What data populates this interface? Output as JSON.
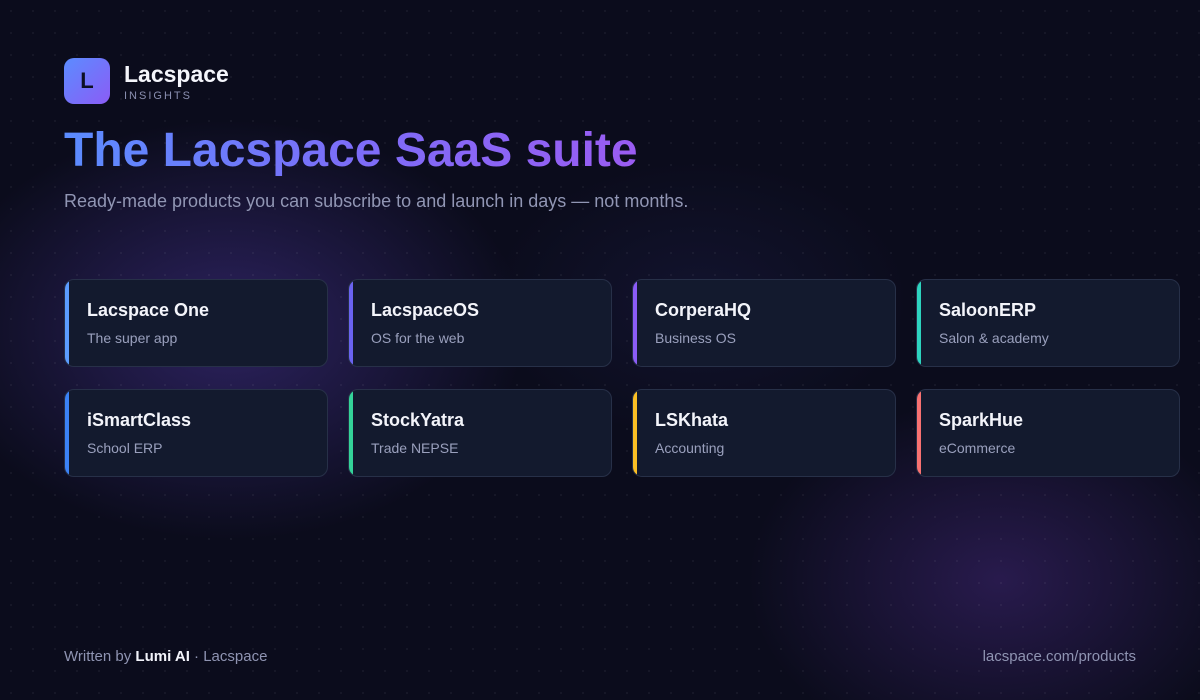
{
  "brand": {
    "logo_letter": "L",
    "name": "Lacspace",
    "tagline": "INSIGHTS"
  },
  "headline": "The Lacspace SaaS suite",
  "subheadline": "Ready-made products you can subscribe to and launch in days — not months.",
  "products": [
    {
      "name": "Lacspace One",
      "description": "The super app",
      "accent": "#5b9cff"
    },
    {
      "name": "LacspaceOS",
      "description": "OS for the web",
      "accent": "#6a63f0"
    },
    {
      "name": "CorperaHQ",
      "description": "Business OS",
      "accent": "#8b5cf6"
    },
    {
      "name": "SaloonERP",
      "description": "Salon & academy",
      "accent": "#2dd4bf"
    },
    {
      "name": "iSmartClass",
      "description": "School ERP",
      "accent": "#3b82f6"
    },
    {
      "name": "StockYatra",
      "description": "Trade NEPSE",
      "accent": "#34d399"
    },
    {
      "name": "LSKhata",
      "description": "Accounting",
      "accent": "#fbbf24"
    },
    {
      "name": "SparkHue",
      "description": "eCommerce",
      "accent": "#f87171"
    }
  ],
  "footer": {
    "written_by": "Written by",
    "author": "Lumi AI",
    "separator": "·",
    "org": "Lacspace",
    "url": "lacspace.com/products"
  },
  "colors": {
    "background": "#0b0c1c",
    "gradient_start": "#5b8cff",
    "gradient_end": "#9a5cf2"
  }
}
